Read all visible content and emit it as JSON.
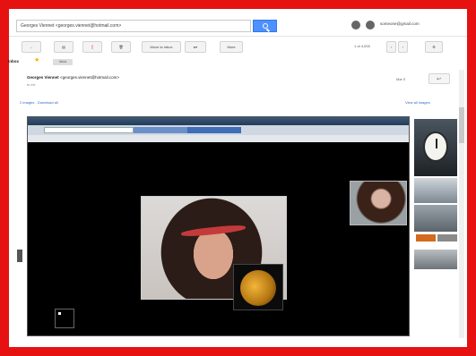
{
  "header": {
    "search_query": "Georges Viennet <georges.viennet@hotmail.com>",
    "account_label": "someone@gmail.com"
  },
  "toolbar": {
    "archive_label": "",
    "move_to_inbox_label": "Move to inbox",
    "more_label": "More",
    "pager_text": "1 of 4,000"
  },
  "message": {
    "folder_label": "Inbox",
    "tag_label": "Inbox",
    "sender_name": "Georges Viennet",
    "sender_email": "<georges.viennet@hotmail.com>",
    "to_line": "to me",
    "date_text": "Mar 5",
    "attachments_text": "2 images",
    "download_text": "Download all",
    "view_all_text": "View all images"
  },
  "screenshot": {
    "title_text": "",
    "menu_text": "",
    "caption": "",
    "left_name": "",
    "left_sub": "",
    "right_name": "",
    "right_sub": ""
  },
  "colors": {
    "frame": "#e61111",
    "search_button": "#4d90fe",
    "star": "#f2b400",
    "caption_text": "#8ccfe6",
    "right_button": "#d46a1e"
  }
}
